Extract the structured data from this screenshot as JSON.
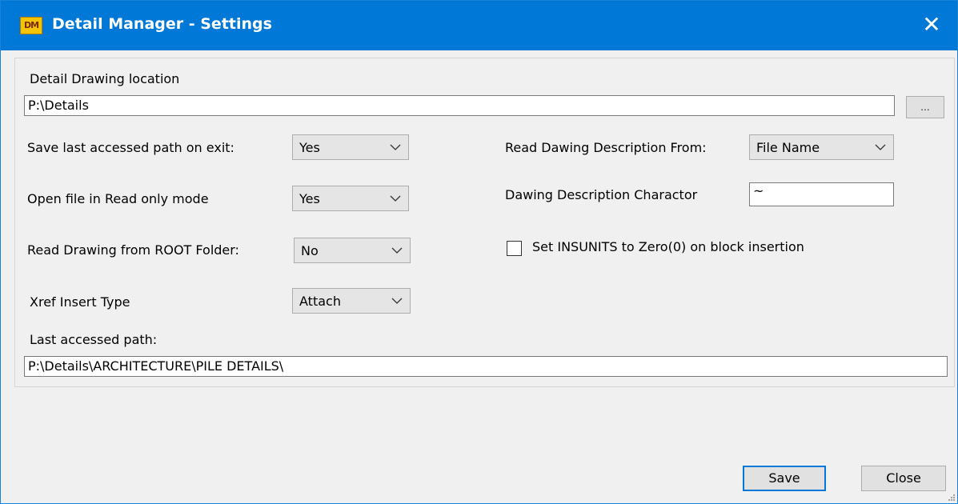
{
  "window": {
    "title": "Detail Manager - Settings",
    "icon_text": "DM",
    "close_glyph": "✕"
  },
  "drawing_location": {
    "label": "Detail Drawing location",
    "value": "P:\\Details",
    "browse_label": "..."
  },
  "left_settings": [
    {
      "label": "Save last accessed path on exit:",
      "value": "Yes"
    },
    {
      "label": "Open file in Read only mode",
      "value": "Yes"
    },
    {
      "label": "Read Drawing from ROOT Folder:",
      "value": "No"
    },
    {
      "label": "Xref Insert Type",
      "value": "Attach"
    }
  ],
  "right_settings": {
    "description_from": {
      "label": "Read Dawing Description From:",
      "value": "File Name"
    },
    "description_char": {
      "label": "Dawing Description Charactor",
      "value": "~"
    },
    "insunits": {
      "label": "Set INSUNITS to Zero(0) on block insertion",
      "checked": false
    }
  },
  "last_path": {
    "label": "Last accessed path:",
    "value": "P:\\Details\\ARCHITECTURE\\PILE DETAILS\\"
  },
  "buttons": {
    "save": "Save",
    "close": "Close"
  },
  "colors": {
    "titlebar": "#0078d7",
    "default_button_border": "#0078d7"
  },
  "icons": {
    "dropdown": "chevron-down-icon",
    "close": "close-icon"
  }
}
